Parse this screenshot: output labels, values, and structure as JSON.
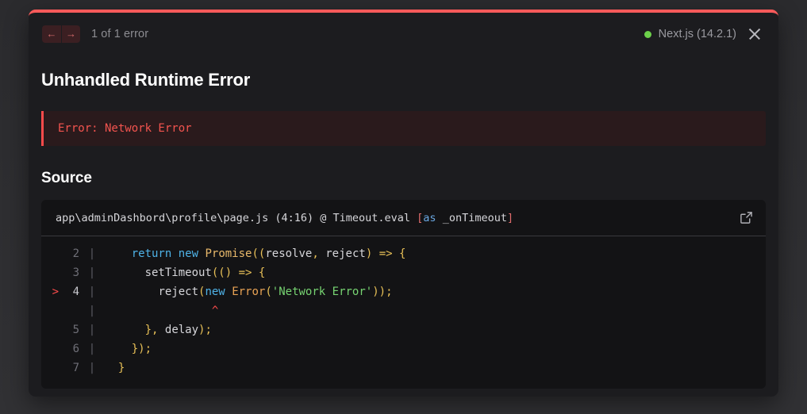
{
  "header": {
    "prev_label": "←",
    "next_label": "→",
    "error_count": "1 of 1 error",
    "version_label": "Next.js (14.2.1)",
    "status_dot_color": "#6cd04a",
    "close_label": "close-icon"
  },
  "error": {
    "title": "Unhandled Runtime Error",
    "message": "Error: Network Error",
    "accent_color": "#fb4b4b"
  },
  "source": {
    "section_title": "Source",
    "file_path_main": "app\\adminDashbord\\profile\\page.js (4:16) @ Timeout.eval ",
    "file_path_bracket_open": "[",
    "file_path_as": "as",
    "file_path_rest": " _onTimeout",
    "file_path_bracket_close": "]",
    "open_editor_icon": "external-link-icon"
  },
  "code": {
    "lines": [
      {
        "number": "2",
        "pipe": "|",
        "marker": "",
        "current": false,
        "tokens": [
          {
            "text": "    ",
            "cls": "t-pln"
          },
          {
            "text": "return",
            "cls": "t-kw"
          },
          {
            "text": " ",
            "cls": "t-pln"
          },
          {
            "text": "new",
            "cls": "t-kw"
          },
          {
            "text": " ",
            "cls": "t-pln"
          },
          {
            "text": "Promise",
            "cls": "t-fn"
          },
          {
            "text": "((",
            "cls": "t-pun"
          },
          {
            "text": "resolve",
            "cls": "t-pln"
          },
          {
            "text": ",",
            "cls": "t-pun"
          },
          {
            "text": " ",
            "cls": "t-pln"
          },
          {
            "text": "reject",
            "cls": "t-pln"
          },
          {
            "text": ")",
            "cls": "t-pun"
          },
          {
            "text": " ",
            "cls": "t-pln"
          },
          {
            "text": "=>",
            "cls": "t-pun"
          },
          {
            "text": " ",
            "cls": "t-pln"
          },
          {
            "text": "{",
            "cls": "t-pun"
          }
        ]
      },
      {
        "number": "3",
        "pipe": "|",
        "marker": "",
        "current": false,
        "tokens": [
          {
            "text": "      ",
            "cls": "t-pln"
          },
          {
            "text": "setTimeout",
            "cls": "t-pln"
          },
          {
            "text": "((",
            "cls": "t-pun"
          },
          {
            "text": ")",
            "cls": "t-pun"
          },
          {
            "text": " ",
            "cls": "t-pln"
          },
          {
            "text": "=>",
            "cls": "t-pun"
          },
          {
            "text": " ",
            "cls": "t-pln"
          },
          {
            "text": "{",
            "cls": "t-pun"
          }
        ]
      },
      {
        "number": "4",
        "pipe": "|",
        "marker": ">",
        "current": true,
        "tokens": [
          {
            "text": "        ",
            "cls": "t-pln"
          },
          {
            "text": "reject",
            "cls": "t-pln"
          },
          {
            "text": "(",
            "cls": "t-pun"
          },
          {
            "text": "new",
            "cls": "t-kw"
          },
          {
            "text": " ",
            "cls": "t-pln"
          },
          {
            "text": "Error",
            "cls": "t-cls"
          },
          {
            "text": "(",
            "cls": "t-pun"
          },
          {
            "text": "'Network Error'",
            "cls": "t-str"
          },
          {
            "text": "));",
            "cls": "t-pun"
          }
        ]
      },
      {
        "number": "",
        "pipe": "|",
        "marker": "",
        "current": false,
        "tokens": [
          {
            "text": "                ",
            "cls": "t-pln"
          },
          {
            "text": "^",
            "cls": "t-caret"
          }
        ]
      },
      {
        "number": "5",
        "pipe": "|",
        "marker": "",
        "current": false,
        "tokens": [
          {
            "text": "      ",
            "cls": "t-pln"
          },
          {
            "text": "}",
            "cls": "t-pun"
          },
          {
            "text": ",",
            "cls": "t-pun"
          },
          {
            "text": " ",
            "cls": "t-pln"
          },
          {
            "text": "delay",
            "cls": "t-pln"
          },
          {
            "text": ")",
            "cls": "t-pun"
          },
          {
            "text": ";",
            "cls": "t-pun"
          }
        ]
      },
      {
        "number": "6",
        "pipe": "|",
        "marker": "",
        "current": false,
        "tokens": [
          {
            "text": "    ",
            "cls": "t-pln"
          },
          {
            "text": "})",
            "cls": "t-pun"
          },
          {
            "text": ";",
            "cls": "t-pun"
          }
        ]
      },
      {
        "number": "7",
        "pipe": "|",
        "marker": "",
        "current": false,
        "tokens": [
          {
            "text": "  ",
            "cls": "t-pln"
          },
          {
            "text": "}",
            "cls": "t-pun"
          }
        ]
      }
    ]
  }
}
